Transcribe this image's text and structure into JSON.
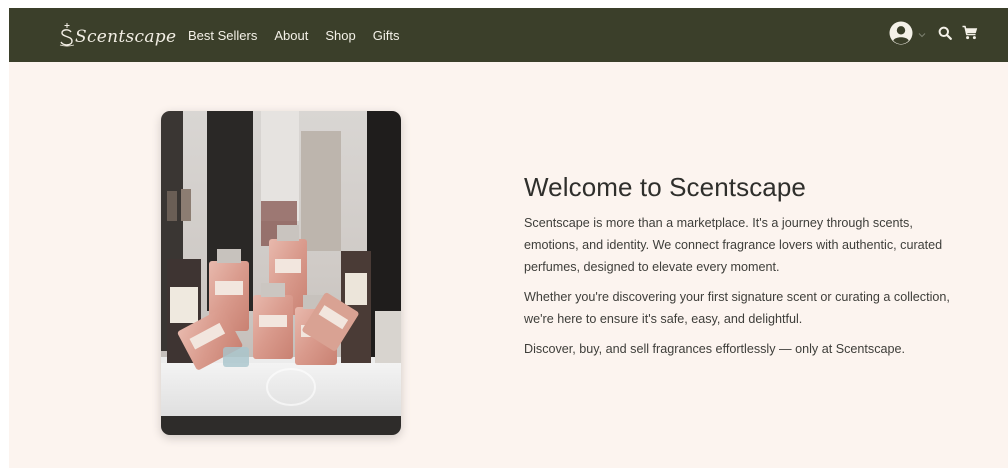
{
  "brand": {
    "name": "Scentscape",
    "logo_text": "Scentscape"
  },
  "nav": {
    "links": [
      {
        "label": "Best Sellers"
      },
      {
        "label": "About"
      },
      {
        "label": "Shop"
      },
      {
        "label": "Gifts"
      }
    ],
    "icons": [
      "user-avatar-icon",
      "chevron-down-icon",
      "search-icon",
      "cart-icon"
    ]
  },
  "hero": {
    "image_subject": "perfume-bottles-on-display-shelf",
    "title": "Welcome to Scentscape",
    "paragraphs": [
      "Scentscape is more than a marketplace. It's a journey through scents, emotions, and identity. We connect fragrance lovers with authentic, curated perfumes, designed to elevate every moment.",
      "Whether you're discovering your first signature scent or curating a collection, we're here to ensure it's safe, easy, and delightful.",
      "Discover, buy, and sell fragrances effortlessly — only at Scentscape."
    ]
  },
  "colors": {
    "navbar_bg": "#3b3f2a",
    "page_bg": "#fcf4ef",
    "nav_text": "#f4f1e8",
    "heading_text": "#2f2f2c"
  }
}
